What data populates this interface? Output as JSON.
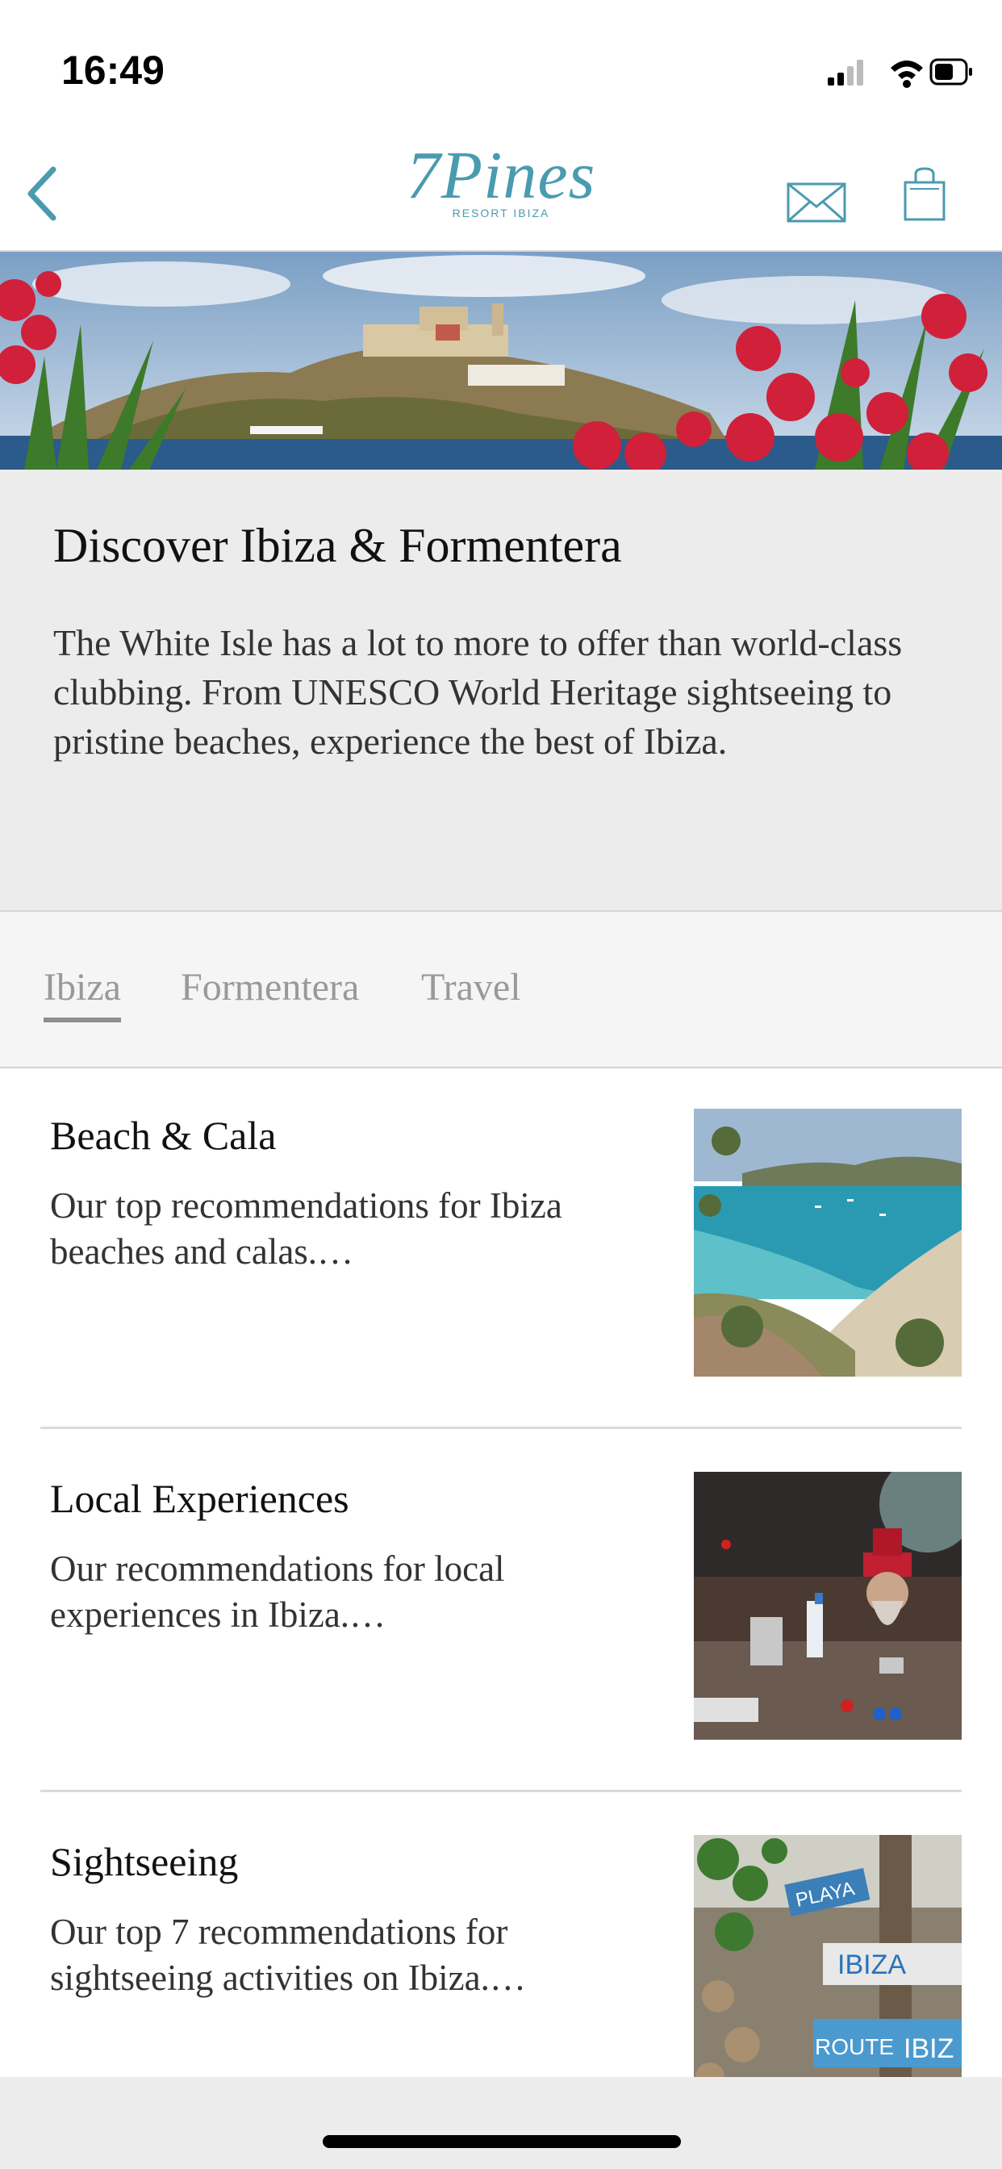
{
  "status_bar": {
    "time": "16:49"
  },
  "header": {
    "logo_main": "7Pines",
    "logo_sub": "RESORT IBIZA",
    "colors": {
      "accent": "#4a9bb0"
    }
  },
  "intro": {
    "title": "Discover Ibiza & Formentera",
    "text": "The White Isle has a lot to more to offer than world-class clubbing. From UNESCO World Heritage sightseeing to pristine beaches, experience the best of Ibiza."
  },
  "tabs": [
    {
      "label": "Ibiza",
      "active": true
    },
    {
      "label": "Formentera",
      "active": false
    },
    {
      "label": "Travel",
      "active": false
    }
  ],
  "items": [
    {
      "title": "Beach & Cala",
      "description": "Our top recommendations for Ibiza beaches and calas.…"
    },
    {
      "title": "Local Experiences",
      "description": "Our recommendations for local experiences in Ibiza.…"
    },
    {
      "title": "Sightseeing",
      "description": "Our top 7 recommendations for sightseeing activities on Ibiza.…"
    }
  ],
  "thumbnail_signs": {
    "sign1": "PLAYA",
    "sign2": "IBIZA",
    "sign3": "ROUTE",
    "sign4": "IBIZ"
  }
}
